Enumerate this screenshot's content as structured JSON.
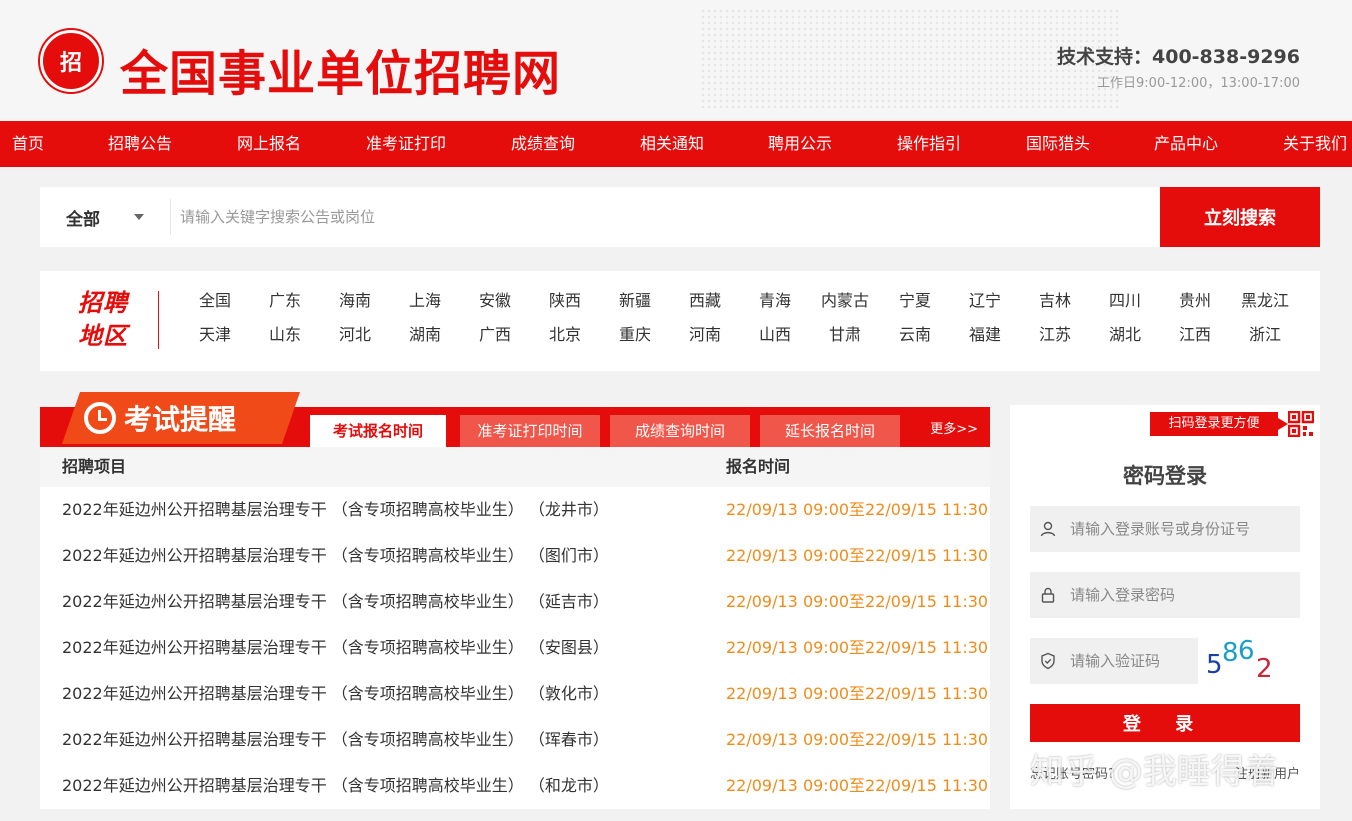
{
  "header": {
    "logo_text": "招",
    "site_title": "全国事业单位招聘网",
    "support_phone": "技术支持：400-838-9296",
    "support_hours": "工作日9:00-12:00，13:00-17:00"
  },
  "nav": {
    "items": [
      "首页",
      "招聘公告",
      "网上报名",
      "准考证打印",
      "成绩查询",
      "相关通知",
      "聘用公示",
      "操作指引",
      "国际猎头",
      "产品中心",
      "关于我们"
    ]
  },
  "search": {
    "scope": "全部",
    "placeholder": "请输入关键字搜索公告或岗位",
    "button": "立刻搜索"
  },
  "regions": {
    "title_line1": "招聘",
    "title_line2": "地区",
    "items": [
      "全国",
      "广东",
      "海南",
      "上海",
      "安徽",
      "陕西",
      "新疆",
      "西藏",
      "青海",
      "内蒙古",
      "宁夏",
      "辽宁",
      "吉林",
      "四川",
      "贵州",
      "黑龙江",
      "天津",
      "山东",
      "河北",
      "湖南",
      "广西",
      "北京",
      "重庆",
      "河南",
      "山西",
      "甘肃",
      "云南",
      "福建",
      "江苏",
      "湖北",
      "江西",
      "浙江"
    ]
  },
  "exam": {
    "title": "考试提醒",
    "tabs": [
      "考试报名时间",
      "准考证打印时间",
      "成绩查询时间",
      "延长报名时间"
    ],
    "more": "更多>>",
    "col_project": "招聘项目",
    "col_time": "报名时间",
    "rows": [
      {
        "project": "2022年延边州公开招聘基层治理专干 （含专项招聘高校毕业生） （龙井市）",
        "time": "22/09/13 09:00至22/09/15 11:30"
      },
      {
        "project": "2022年延边州公开招聘基层治理专干 （含专项招聘高校毕业生） （图们市）",
        "time": "22/09/13 09:00至22/09/15 11:30"
      },
      {
        "project": "2022年延边州公开招聘基层治理专干 （含专项招聘高校毕业生） （延吉市）",
        "time": "22/09/13 09:00至22/09/15 11:30"
      },
      {
        "project": "2022年延边州公开招聘基层治理专干 （含专项招聘高校毕业生） （安图县）",
        "time": "22/09/13 09:00至22/09/15 11:30"
      },
      {
        "project": "2022年延边州公开招聘基层治理专干 （含专项招聘高校毕业生） （敦化市）",
        "time": "22/09/13 09:00至22/09/15 11:30"
      },
      {
        "project": "2022年延边州公开招聘基层治理专干 （含专项招聘高校毕业生） （珲春市）",
        "time": "22/09/13 09:00至22/09/15 11:30"
      },
      {
        "project": "2022年延边州公开招聘基层治理专干 （含专项招聘高校毕业生） （和龙市）",
        "time": "22/09/13 09:00至22/09/15 11:30"
      }
    ]
  },
  "login": {
    "qr_tag": "扫码登录更方便",
    "title": "密码登录",
    "account_placeholder": "请输入登录账号或身份证号",
    "password_placeholder": "请输入登录密码",
    "captcha_placeholder": "请输入验证码",
    "captcha_chars": [
      "5",
      "8",
      "6",
      "2"
    ],
    "button": "登 录",
    "forgot": "忘记账号密码?",
    "register": "注册新用户"
  },
  "watermark": "知乎 @我睡得着",
  "colors": {
    "brand_red": "#e50c0c",
    "time_orange": "#f08c1c"
  }
}
